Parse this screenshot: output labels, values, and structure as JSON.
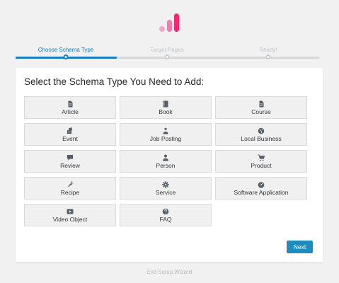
{
  "brand": {
    "colors": [
      "#f0a8c8",
      "#f17aae",
      "#ee2b70"
    ]
  },
  "wizard": {
    "steps": [
      {
        "label": "Choose Schema Type",
        "state": "active"
      },
      {
        "label": "Target Pages",
        "state": "inactive"
      },
      {
        "label": "Ready!",
        "state": "inactive"
      }
    ],
    "progress": 0.3333
  },
  "main": {
    "heading": "Select the Schema Type You Need to Add:",
    "schema_types": [
      {
        "label": "Article",
        "icon": "document-icon"
      },
      {
        "label": "Book",
        "icon": "book-icon"
      },
      {
        "label": "Course",
        "icon": "document-icon"
      },
      {
        "label": "Event",
        "icon": "event-icon"
      },
      {
        "label": "Job Posting",
        "icon": "people-icon"
      },
      {
        "label": "Local Business",
        "icon": "globe-icon"
      },
      {
        "label": "Review",
        "icon": "comment-icon"
      },
      {
        "label": "Person",
        "icon": "person-icon"
      },
      {
        "label": "Product",
        "icon": "cart-icon"
      },
      {
        "label": "Recipe",
        "icon": "carrot-icon"
      },
      {
        "label": "Service",
        "icon": "gear-icon"
      },
      {
        "label": "Software Application",
        "icon": "dashboard-icon"
      },
      {
        "label": "Video Object",
        "icon": "video-icon"
      },
      {
        "label": "FAQ",
        "icon": "question-icon"
      }
    ],
    "next_label": "Next"
  },
  "footer": {
    "exit_label": "Exit Setup Wizard"
  }
}
